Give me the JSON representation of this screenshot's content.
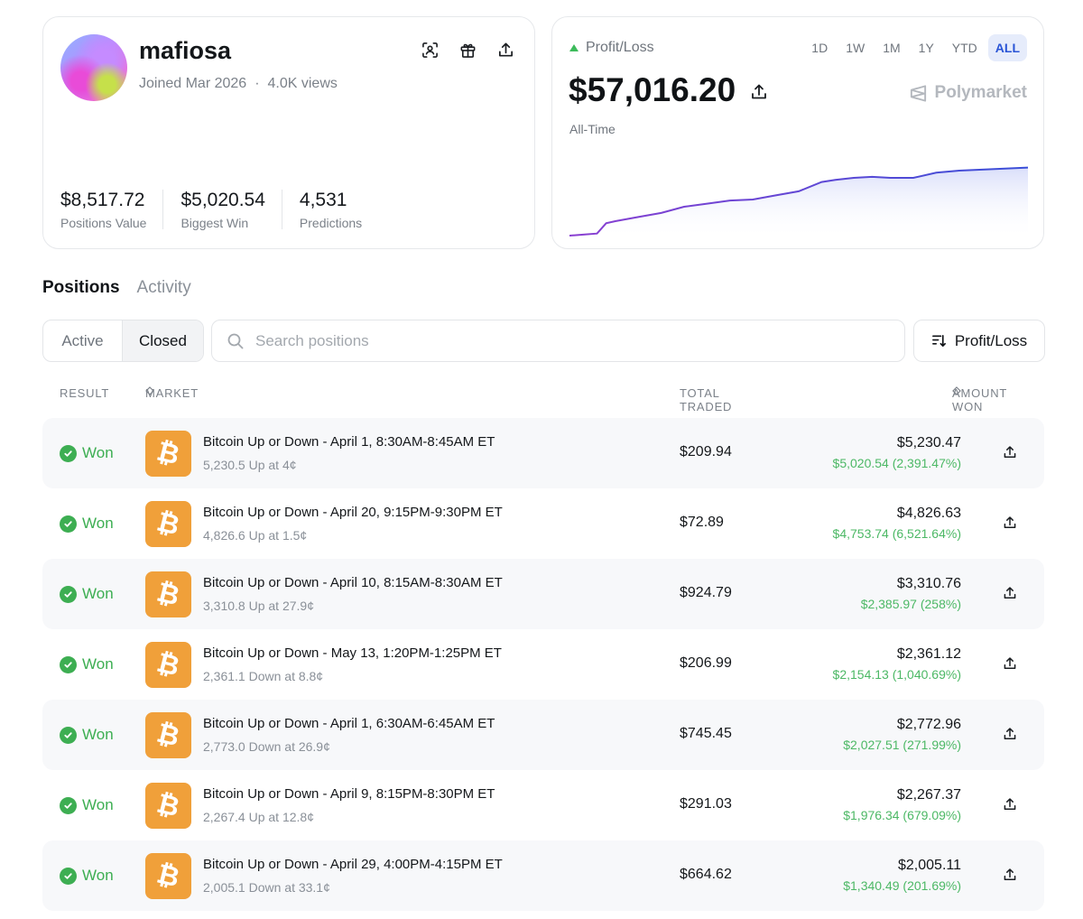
{
  "profile": {
    "username": "mafiosa",
    "joined": "Joined Mar 2026",
    "separator": "·",
    "views": "4.0K views",
    "icons": [
      "scan-icon",
      "gift-icon",
      "share-icon"
    ],
    "stats": [
      {
        "value": "$8,517.72",
        "label": "Positions Value"
      },
      {
        "value": "$5,020.54",
        "label": "Biggest Win"
      },
      {
        "value": "4,531",
        "label": "Predictions"
      }
    ]
  },
  "pnl": {
    "label": "Profit/Loss",
    "value": "$57,016.20",
    "period": "All-Time",
    "brand": "Polymarket",
    "ranges": [
      "1D",
      "1W",
      "1M",
      "1Y",
      "YTD",
      "ALL"
    ],
    "active_range": "ALL",
    "colors": {
      "line": "#4a4fd6",
      "fill": "#dfe3fb",
      "up": "#3dbb5b"
    }
  },
  "chart_data": {
    "type": "area",
    "x": [
      0,
      0.03,
      0.06,
      0.08,
      0.1,
      0.15,
      0.2,
      0.25,
      0.3,
      0.35,
      0.4,
      0.45,
      0.5,
      0.55,
      0.58,
      0.62,
      0.66,
      0.7,
      0.75,
      0.8,
      0.85,
      0.9,
      0.95,
      1.0
    ],
    "values": [
      0,
      1,
      2,
      12,
      14,
      18,
      22,
      28,
      31,
      34,
      35,
      39,
      43,
      52,
      54,
      56,
      57,
      56,
      56,
      61,
      63,
      64,
      65,
      66
    ],
    "title": "",
    "xlabel": "",
    "ylabel": "",
    "ylim": [
      0,
      70
    ],
    "grid": false
  },
  "tabs": [
    "Positions",
    "Activity"
  ],
  "active_tab": "Positions",
  "filter": {
    "active": "Active",
    "closed": "Closed"
  },
  "search": {
    "placeholder": "Search positions",
    "value": ""
  },
  "sort": {
    "label": "Profit/Loss"
  },
  "table": {
    "headers": {
      "result": "RESULT",
      "market": "MARKET",
      "traded": "TOTAL TRADED",
      "won": "AMOUNT WON"
    },
    "rows": [
      {
        "result": "Won",
        "title": "Bitcoin Up or Down - April 1, 8:30AM-8:45AM ET",
        "sub": "5,230.5 Up at 4¢",
        "traded": "$209.94",
        "won": "$5,230.47",
        "gain": "$5,020.54 (2,391.47%)"
      },
      {
        "result": "Won",
        "title": "Bitcoin Up or Down - April 20, 9:15PM-9:30PM ET",
        "sub": "4,826.6 Up at 1.5¢",
        "traded": "$72.89",
        "won": "$4,826.63",
        "gain": "$4,753.74 (6,521.64%)"
      },
      {
        "result": "Won",
        "title": "Bitcoin Up or Down - April 10, 8:15AM-8:30AM ET",
        "sub": "3,310.8 Up at 27.9¢",
        "traded": "$924.79",
        "won": "$3,310.76",
        "gain": "$2,385.97 (258%)"
      },
      {
        "result": "Won",
        "title": "Bitcoin Up or Down - May 13, 1:20PM-1:25PM ET",
        "sub": "2,361.1 Down at 8.8¢",
        "traded": "$206.99",
        "won": "$2,361.12",
        "gain": "$2,154.13 (1,040.69%)"
      },
      {
        "result": "Won",
        "title": "Bitcoin Up or Down - April 1, 6:30AM-6:45AM ET",
        "sub": "2,773.0 Down at 26.9¢",
        "traded": "$745.45",
        "won": "$2,772.96",
        "gain": "$2,027.51 (271.99%)"
      },
      {
        "result": "Won",
        "title": "Bitcoin Up or Down - April 9, 8:15PM-8:30PM ET",
        "sub": "2,267.4 Up at 12.8¢",
        "traded": "$291.03",
        "won": "$2,267.37",
        "gain": "$1,976.34 (679.09%)"
      },
      {
        "result": "Won",
        "title": "Bitcoin Up or Down - April 29, 4:00PM-4:15PM ET",
        "sub": "2,005.1 Down at 33.1¢",
        "traded": "$664.62",
        "won": "$2,005.11",
        "gain": "$1,340.49 (201.69%)"
      }
    ]
  },
  "btc_symbol": "₿"
}
